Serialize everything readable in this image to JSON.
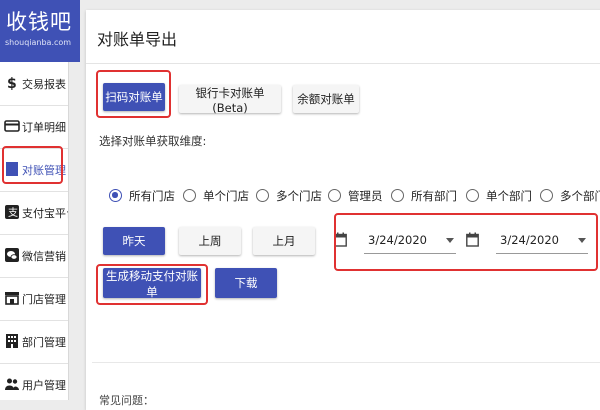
{
  "logo": {
    "title": "收钱吧",
    "subtitle": "shouqianba.com"
  },
  "sidebar": {
    "items": [
      {
        "label": "交易报表",
        "icon": "dollar-icon"
      },
      {
        "label": "订单明细",
        "icon": "card-icon"
      },
      {
        "label": "对账管理",
        "icon": "document-icon",
        "active": true
      },
      {
        "label": "支付宝平台",
        "icon": "alipay-icon"
      },
      {
        "label": "微信营销",
        "icon": "wechat-icon"
      },
      {
        "label": "门店管理",
        "icon": "store-icon"
      },
      {
        "label": "部门管理",
        "icon": "building-icon"
      },
      {
        "label": "用户管理",
        "icon": "users-icon"
      }
    ]
  },
  "page": {
    "title": "对账单导出"
  },
  "tabs": {
    "scan": "扫码对账单",
    "bank": "银行卡对账单(Beta)",
    "balance": "余额对账单"
  },
  "dimension": {
    "label": "选择对账单获取维度:",
    "options": [
      "所有门店",
      "单个门店",
      "多个门店",
      "管理员",
      "所有部门",
      "单个部门",
      "多个部门"
    ],
    "selected": "所有门店"
  },
  "range_buttons": {
    "yesterday": "昨天",
    "last_week": "上周",
    "last_month": "上月"
  },
  "dates": {
    "start": "3/24/2020",
    "end": "3/24/2020"
  },
  "actions": {
    "generate": "生成移动支付对账单",
    "download": "下载"
  },
  "section_peek": "常见问题：",
  "colors": {
    "accent": "#3f51b5",
    "highlight": "#e03131"
  }
}
